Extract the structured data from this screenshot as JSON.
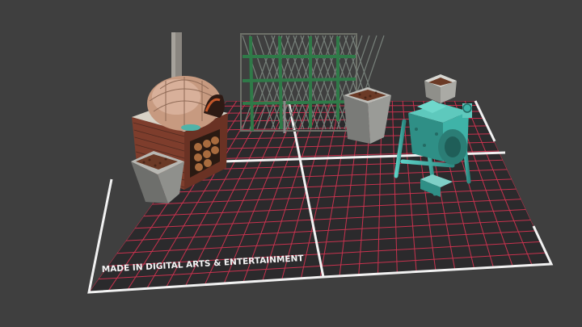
{
  "scene": {
    "caption": "MADE IN DIGITAL ARTS & ENTERTAINMENT",
    "colors": {
      "background": "#3f3f3f",
      "floor": "#2b2a2c",
      "grid_line": "#c8324e",
      "floor_border": "#f2f2f2",
      "brick": "#8a4a35",
      "planter": "#8f8f8c",
      "fence_green": "#2f7a48",
      "machine_teal": "#3fb3a8"
    },
    "objects": [
      "pizza-oven",
      "planter",
      "wire-fence",
      "planter",
      "grain-machine"
    ]
  }
}
